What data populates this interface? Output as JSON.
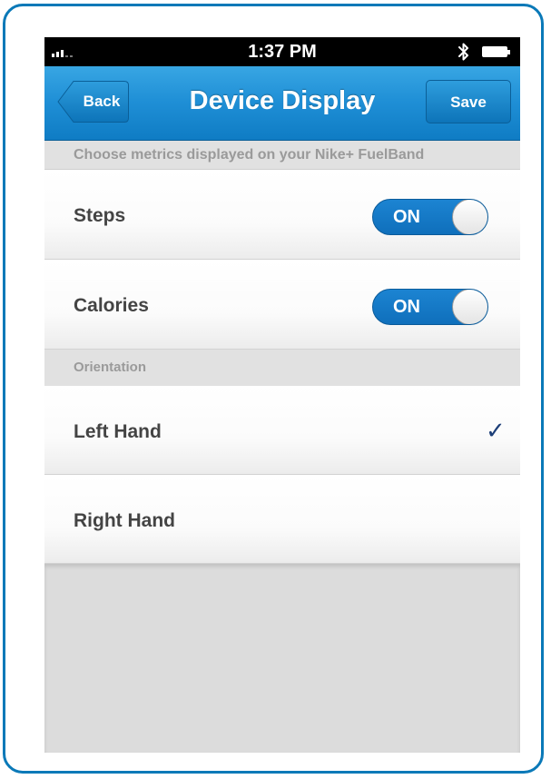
{
  "status_bar": {
    "time": "1:37 PM",
    "signal_icon": "signal-bars-icon",
    "bluetooth_icon": "bluetooth-icon",
    "battery_icon": "battery-icon"
  },
  "nav": {
    "back_label": "Back",
    "title": "Device Display",
    "save_label": "Save",
    "accent_color": "#1f8fd6"
  },
  "metrics_section": {
    "header": "Choose metrics displayed on your Nike+ FuelBand",
    "items": [
      {
        "label": "Steps",
        "toggle": "ON"
      },
      {
        "label": "Calories",
        "toggle": "ON"
      }
    ]
  },
  "orientation_section": {
    "header": "Orientation",
    "options": [
      {
        "label": "Left Hand",
        "selected": true
      },
      {
        "label": "Right Hand",
        "selected": false
      }
    ],
    "check_glyph": "✓",
    "check_color": "#1d3f78"
  }
}
